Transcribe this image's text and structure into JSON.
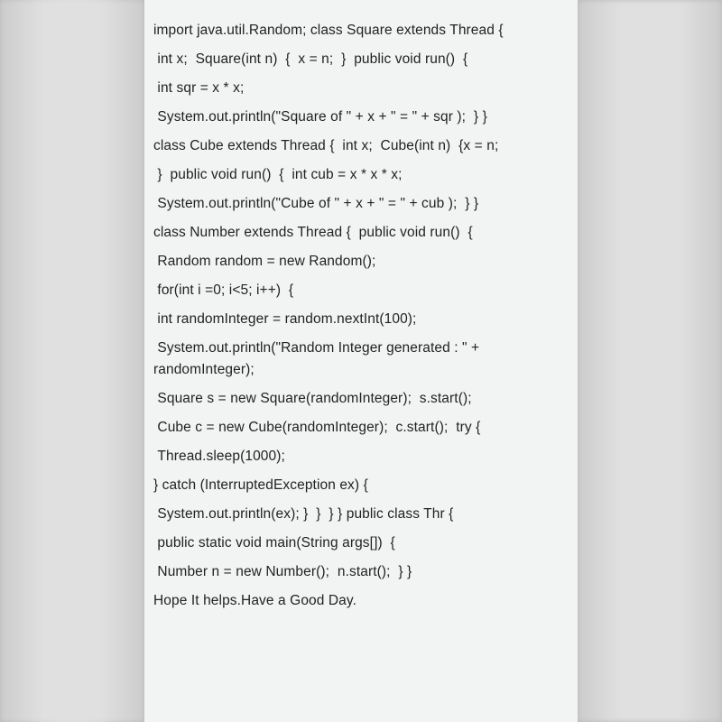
{
  "lines": [
    "import java.util.Random; class Square extends Thread {",
    " int x;  Square(int n)  {  x = n;  }  public void run()  {",
    " int sqr = x * x;",
    " System.out.println(\"Square of \" + x + \" = \" + sqr );  } }",
    "class Cube extends Thread {  int x;  Cube(int n)  {x = n;",
    " }  public void run()  {  int cub = x * x * x;",
    " System.out.println(\"Cube of \" + x + \" = \" + cub );  } }",
    "class Number extends Thread {  public void run()  {",
    " Random random = new Random();",
    " for(int i =0; i<5; i++)  {",
    " int randomInteger = random.nextInt(100);",
    " System.out.println(\"Random Integer generated : \" + randomInteger);",
    " Square s = new Square(randomInteger);  s.start();",
    " Cube c = new Cube(randomInteger);  c.start();  try {",
    " Thread.sleep(1000);",
    "} catch (InterruptedException ex) {",
    " System.out.println(ex); }  }  } } public class Thr {",
    " public static void main(String args[])  {",
    " Number n = new Number();  n.start();  } }",
    "Hope It helps.Have a Good Day."
  ]
}
